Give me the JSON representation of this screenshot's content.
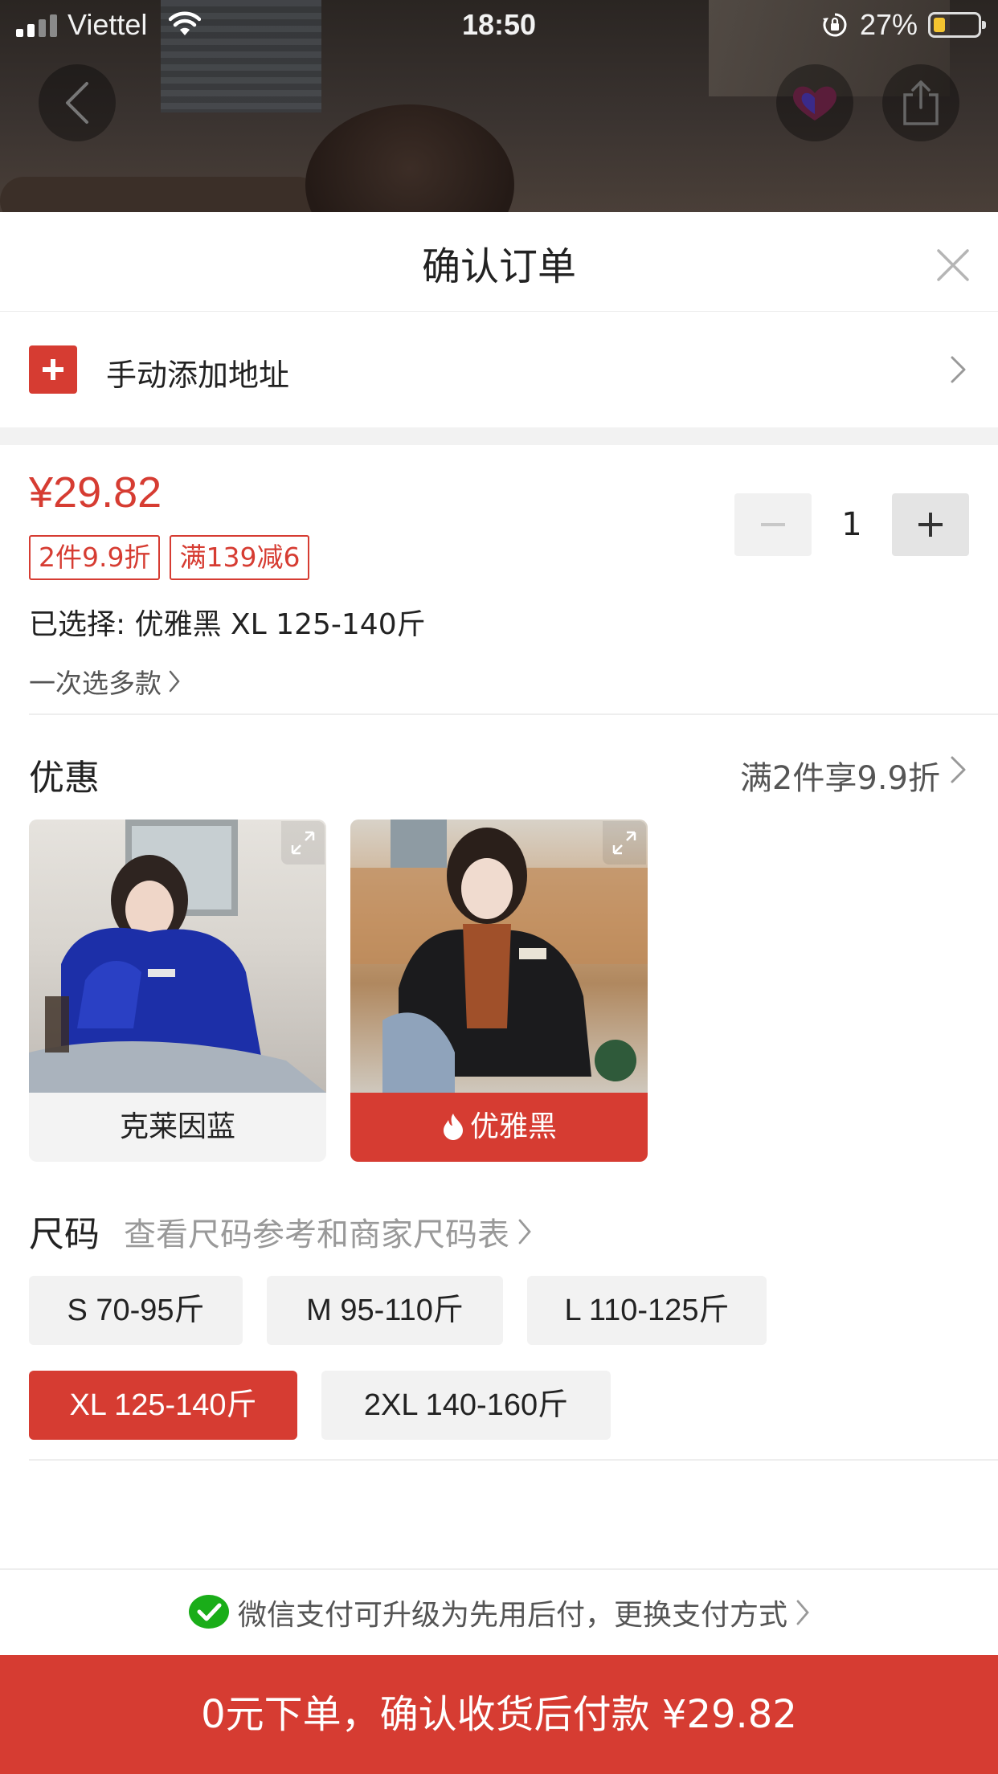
{
  "status_bar": {
    "carrier": "Viettel",
    "time": "18:50",
    "battery": "27%",
    "battery_level": 0.27,
    "signal_bars": 2,
    "icons": [
      "signal-icon",
      "wifi-icon",
      "orientation-lock-icon",
      "battery-icon"
    ]
  },
  "header": {
    "icons": [
      "back-icon",
      "brand-icon",
      "share-icon"
    ]
  },
  "sheet": {
    "title": "确认订单",
    "close_icon": "close-icon"
  },
  "address": {
    "label": "手动添加地址",
    "icon": "plus-icon"
  },
  "product": {
    "price": "¥29.82",
    "promo_tags": [
      "2件9.9折",
      "满139减6"
    ],
    "selected": "已选择: 优雅黑 XL 125-140斤",
    "multi_select_link": "一次选多款",
    "quantity": "1"
  },
  "discount": {
    "title": "优惠",
    "right_text": "满2件享9.9折"
  },
  "colors": [
    {
      "label": "克莱因蓝",
      "selected": false
    },
    {
      "label": "优雅黑",
      "selected": true,
      "icon": "flame-icon"
    }
  ],
  "size": {
    "title": "尺码",
    "link": "查看尺码参考和商家尺码表",
    "options": [
      {
        "label": "S 70-95斤",
        "selected": false
      },
      {
        "label": "M 95-110斤",
        "selected": false
      },
      {
        "label": "L 110-125斤",
        "selected": false
      },
      {
        "label": "XL 125-140斤",
        "selected": true
      },
      {
        "label": "2XL 140-160斤",
        "selected": false
      }
    ]
  },
  "payment": {
    "text": "微信支付可升级为先用后付，更换支付方式",
    "icon": "wechat-icon"
  },
  "order_button": {
    "label": "0元下单，确认收货后付款 ¥29.82"
  },
  "colors_theme": {
    "accent": "#d63c32",
    "chip_bg": "#f2f2f2",
    "wechat_green": "#1aad19"
  }
}
